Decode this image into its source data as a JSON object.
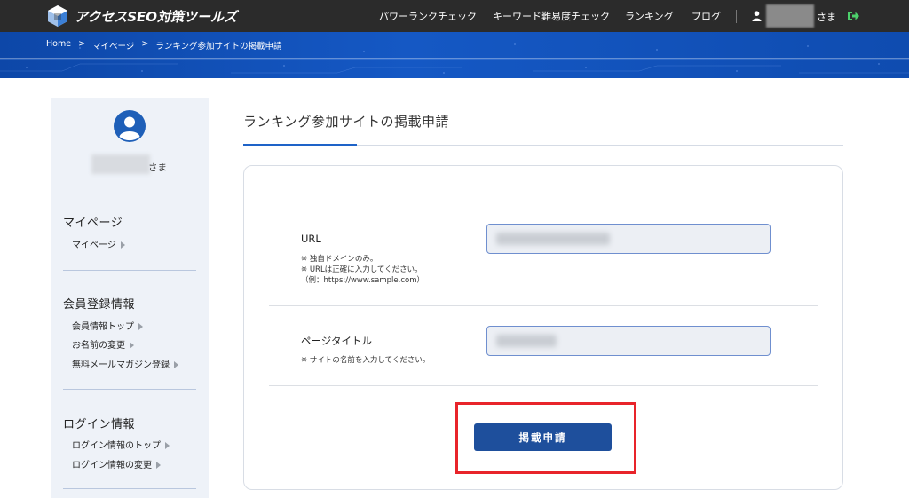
{
  "header": {
    "logo_text": "アクセスSEO対策ツールズ",
    "nav": [
      {
        "label": "パワーランクチェック"
      },
      {
        "label": "キーワード難易度チェック"
      },
      {
        "label": "ランキング"
      },
      {
        "label": "ブログ"
      }
    ],
    "user_suffix": "さま"
  },
  "breadcrumb": [
    {
      "label": "Home"
    },
    {
      "label": "マイページ"
    },
    {
      "label": "ランキング参加サイトの掲載申請"
    }
  ],
  "breadcrumb_sep": ">",
  "sidebar": {
    "user_suffix": "さま",
    "sections": [
      {
        "heading": "マイページ",
        "links": [
          "マイページ"
        ]
      },
      {
        "heading": "会員登録情報",
        "links": [
          "会員情報トップ",
          "お名前の変更",
          "無料メールマガジン登録"
        ]
      },
      {
        "heading": "ログイン情報",
        "links": [
          "ログイン情報のトップ",
          "ログイン情報の変更"
        ]
      }
    ]
  },
  "main": {
    "title": "ランキング参加サイトの掲載申請",
    "url_field": {
      "label": "URL",
      "notes": [
        "※ 独自ドメインのみ。",
        "※ URLは正確に入力してください。",
        "（例：https://www.sample.com）"
      ]
    },
    "page_title_field": {
      "label": "ページタイトル",
      "notes": [
        "※ サイトの名前を入力してください。"
      ]
    },
    "submit_label": "掲載申請"
  },
  "colors": {
    "topbar": "#2b2b2b",
    "band": "#1558c4",
    "accent": "#1e63c8",
    "button": "#1e4f9c",
    "highlight": "#e8242a",
    "logout": "#4cd06b"
  }
}
